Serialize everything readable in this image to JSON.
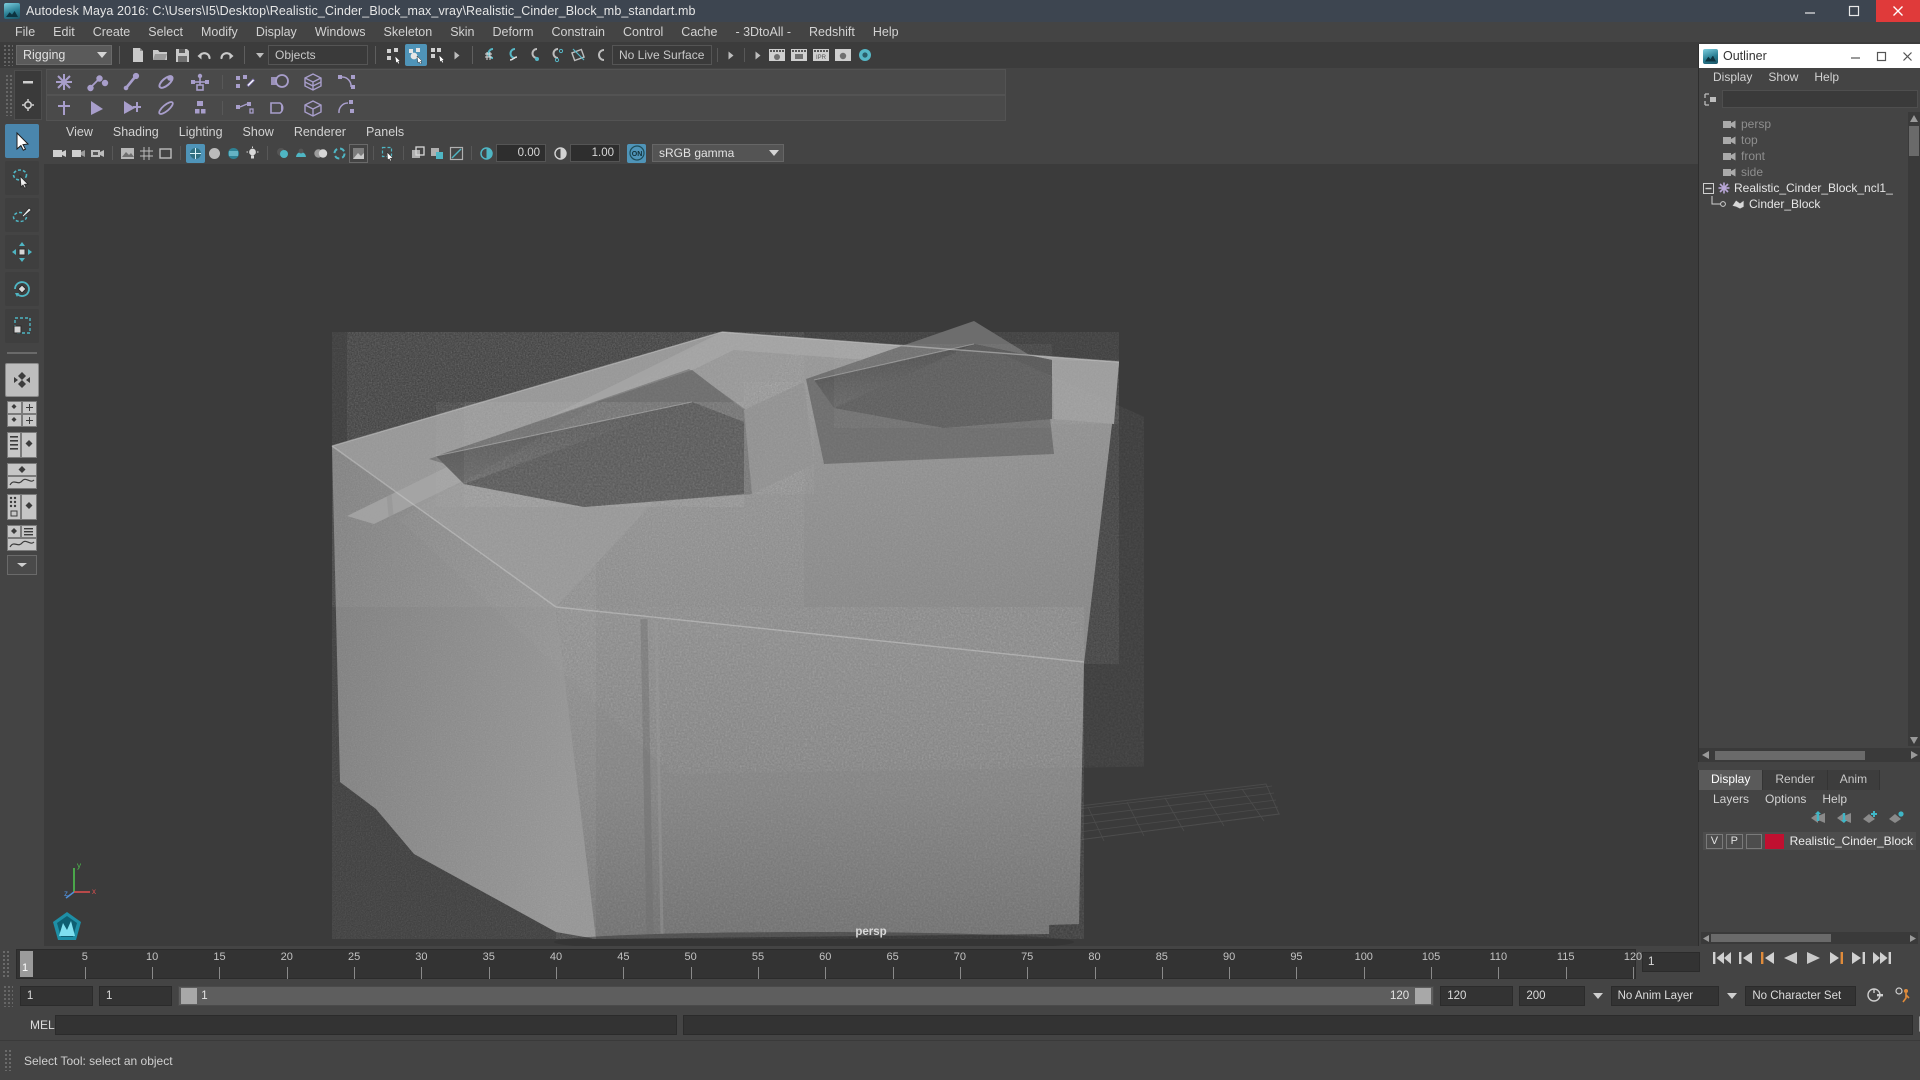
{
  "window": {
    "title": "Autodesk Maya 2016: C:\\Users\\I5\\Desktop\\Realistic_Cinder_Block_max_vray\\Realistic_Cinder_Block_mb_standart.mb",
    "app_icon": "maya-icon",
    "minimize": "minimize-icon",
    "maximize": "maximize-icon",
    "close": "close-icon",
    "close_color": "#e03a3a"
  },
  "menubar": {
    "items": [
      "File",
      "Edit",
      "Create",
      "Select",
      "Modify",
      "Display",
      "Windows",
      "Skeleton",
      "Skin",
      "Deform",
      "Constrain",
      "Control",
      "Cache",
      "- 3DtoAll -",
      "Redshift",
      "Help"
    ]
  },
  "statusline": {
    "menu_set": "Rigging",
    "selection_mask": "Objects",
    "live_surface": "No Live Surface",
    "icons": [
      "new-scene-icon",
      "open-scene-icon",
      "save-scene-icon",
      "undo-icon",
      "redo-icon",
      "select-hierarchy-icon",
      "select-object-icon",
      "select-component-icon",
      "snap-grid-icon",
      "snap-curve-icon",
      "snap-point-icon",
      "snap-projected-center-icon",
      "snap-view-plane-icon",
      "make-live-icon",
      "render-view-icon",
      "render-sequence-icon",
      "ipr-render-icon",
      "render-settings-icon"
    ],
    "active_icon": "select-object-icon"
  },
  "shelf": {
    "row1_icons": [
      "joint-tool-icon",
      "ik-handle-icon",
      "ik-spline-handle-icon",
      "insert-joint-icon",
      "skeleton-rig-icon",
      "bind-skin-icon",
      "interactive-bind-icon",
      "lattice-icon",
      "cluster-icon"
    ],
    "row2_icons": [
      "orient-joint-icon",
      "mirror-joint-icon",
      "connect-joint-icon",
      "paint-weights-icon",
      "joint-label-icon",
      "blend-shape-icon",
      "wrap-deformer-icon",
      "wire-deformer-icon",
      "soft-mod-icon"
    ],
    "tab_collapse": "shelf-collapse-icon",
    "tab_settings": "shelf-settings-icon"
  },
  "toolbox": {
    "tools": [
      {
        "name": "select-tool",
        "selected": true
      },
      {
        "name": "lasso-select-tool",
        "selected": false
      },
      {
        "name": "paint-select-tool",
        "selected": false
      },
      {
        "name": "move-tool",
        "selected": false
      },
      {
        "name": "rotate-tool",
        "selected": false
      },
      {
        "name": "scale-tool",
        "selected": false
      }
    ],
    "layouts": [
      "single-perspective-layout",
      "four-view-layout",
      "outliner-persp-layout",
      "persp-graph-layout",
      "hypershade-persp-layout",
      "persp-graph-outliner-layout"
    ],
    "more_layouts": "layout-dropdown-icon"
  },
  "viewport": {
    "menus": [
      "View",
      "Shading",
      "Lighting",
      "Show",
      "Renderer",
      "Panels"
    ],
    "toolbar_icons": [
      "select-camera-icon",
      "bookmark-icon",
      "image-plane-icon",
      "two-sided-lighting-icon",
      "shadows-icon",
      "ao-icon",
      "aa-icon",
      "multisample-icon",
      "xray-icon",
      "xray-joints-icon",
      "xray-active-icon",
      "exposure-icon",
      "gamma-icon",
      "color-management-icon"
    ],
    "exposure_value": "0.00",
    "gamma_value": "1.00",
    "color_toggle": "ON",
    "view_transform": "sRGB gamma",
    "camera_label": "persp",
    "gizmo_axes": [
      "x",
      "y",
      "z"
    ],
    "background_color": "#3b3b3b"
  },
  "outliner": {
    "title": "Outliner",
    "menus": [
      "Display",
      "Show",
      "Help"
    ],
    "search_icon": "outliner-filter-icon",
    "search_value": "",
    "items": [
      {
        "label": "persp",
        "icon": "camera-icon",
        "indent": 1,
        "dim": true
      },
      {
        "label": "top",
        "icon": "camera-icon",
        "indent": 1,
        "dim": true
      },
      {
        "label": "front",
        "icon": "camera-icon",
        "indent": 1,
        "dim": true
      },
      {
        "label": "side",
        "icon": "camera-icon",
        "indent": 1,
        "dim": true
      },
      {
        "label": "Realistic_Cinder_Block_ncl1_",
        "icon": "transform-icon",
        "indent": 0,
        "dim": false,
        "expander": "minus"
      },
      {
        "label": "Cinder_Block",
        "icon": "mesh-icon",
        "indent": 2,
        "dim": false
      }
    ]
  },
  "layer_editor": {
    "tabs": [
      {
        "label": "Display",
        "active": true
      },
      {
        "label": "Render",
        "active": false
      },
      {
        "label": "Anim",
        "active": false
      }
    ],
    "menus": [
      "Layers",
      "Options",
      "Help"
    ],
    "toolbar_icons": [
      "move-layer-up-icon",
      "move-layer-down-icon",
      "new-layer-icon",
      "new-layer-from-selected-icon"
    ],
    "layers": [
      {
        "visibility": "V",
        "playback": "P",
        "type": "",
        "color": "#c01030",
        "name": "Realistic_Cinder_Block"
      }
    ]
  },
  "timeline": {
    "current_frame": "1",
    "cursor_label": "1",
    "ticks": [
      5,
      10,
      15,
      20,
      25,
      30,
      35,
      40,
      45,
      50,
      55,
      60,
      65,
      70,
      75,
      80,
      85,
      90,
      95,
      100,
      105,
      110,
      115,
      120
    ],
    "start": 1,
    "end": 120,
    "playback_icons": [
      "go-to-start-icon",
      "step-back-key-icon",
      "step-back-frame-icon",
      "play-backwards-icon",
      "play-forwards-icon",
      "step-forward-frame-icon",
      "step-forward-key-icon",
      "go-to-end-icon"
    ]
  },
  "range": {
    "anim_start": "1",
    "range_start": "1",
    "slider_label": "1",
    "slider_end_label": "120",
    "range_end": "120",
    "anim_end": "200",
    "anim_layer": "No Anim Layer",
    "character_set": "No Character Set",
    "auto_key_icon": "auto-keyframe-icon",
    "anim_prefs_icon": "animation-preferences-icon"
  },
  "command_line": {
    "label": "MEL",
    "value": "",
    "script_editor_icon": "script-editor-icon"
  },
  "help_line": {
    "text": "Select Tool: select an object"
  }
}
